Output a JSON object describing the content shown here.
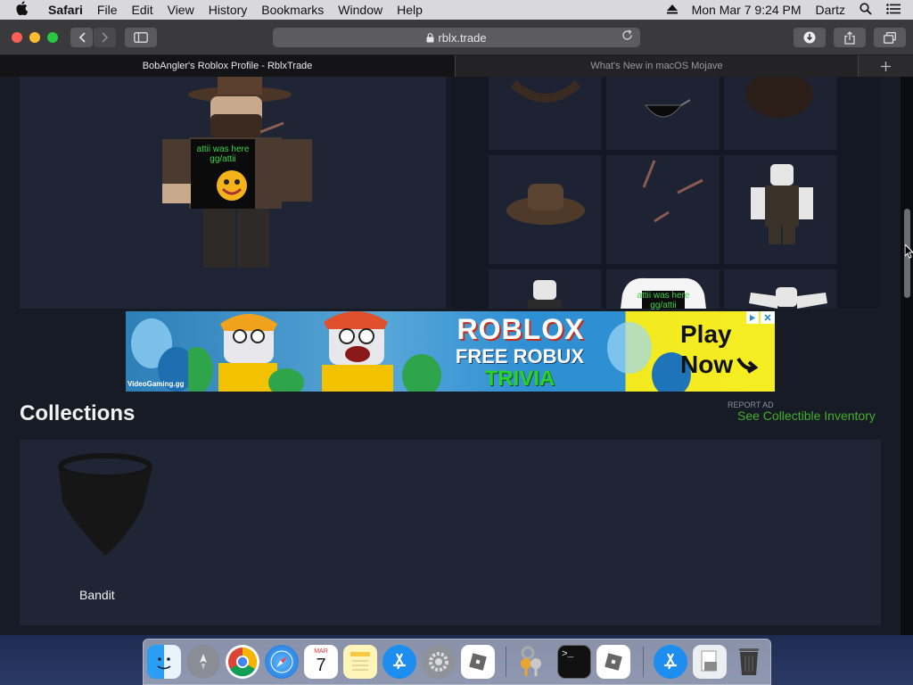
{
  "menubar": {
    "apple": "",
    "items": [
      "Safari",
      "File",
      "Edit",
      "View",
      "History",
      "Bookmarks",
      "Window",
      "Help"
    ],
    "datetime": "Mon Mar 7  9:24 PM",
    "user": "Dartz"
  },
  "browser": {
    "url": "rblx.trade",
    "tabs": [
      {
        "label": "BobAngler's Roblox Profile - RblxTrade"
      },
      {
        "label": "What's New in macOS Mojave"
      }
    ]
  },
  "avatar_shirt_text": "attii was here\ngg/attii",
  "inventory_shirt_text": "attii was here\ngg/attii",
  "ad": {
    "headline": "ROBLOX",
    "subline1": "FREE ROBUX",
    "subline2": "TRIVIA",
    "cta_line1": "Play",
    "cta_line2": "Now",
    "watermark": "VideoGaming.gg",
    "report_label": "REPORT AD"
  },
  "collections": {
    "title": "Collections",
    "link": "See Collectible Inventory",
    "items": [
      {
        "name": "Bandit"
      }
    ]
  },
  "dock": {
    "calendar_month": "MAR",
    "calendar_day": "7",
    "terminal_prompt": ">_"
  },
  "colors": {
    "accent_link": "#43b02a",
    "page_bg": "#171b26",
    "panel_bg": "#1f2535"
  }
}
